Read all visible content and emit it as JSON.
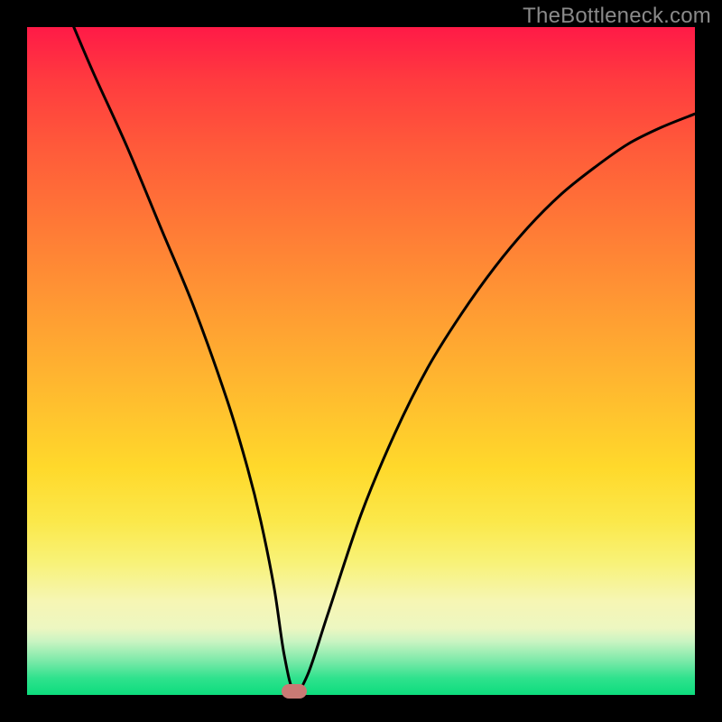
{
  "watermark": "TheBottleneck.com",
  "chart_data": {
    "type": "line",
    "title": "",
    "xlabel": "",
    "ylabel": "",
    "xlim": [
      0,
      100
    ],
    "ylim": [
      0,
      100
    ],
    "grid": false,
    "series": [
      {
        "name": "curve",
        "color": "#000000",
        "x": [
          7,
          10,
          15,
          20,
          25,
          30,
          33,
          35,
          37,
          38.5,
          40,
          42,
          45,
          50,
          55,
          60,
          65,
          70,
          75,
          80,
          85,
          90,
          95,
          100
        ],
        "y": [
          100,
          93,
          82,
          70,
          58,
          44,
          34,
          26,
          16,
          6,
          0.5,
          3,
          12,
          27,
          39,
          49,
          57,
          64,
          70,
          75,
          79,
          82.5,
          85,
          87
        ]
      }
    ],
    "marker": {
      "x": 40,
      "y": 0.5,
      "color": "#c97a74"
    },
    "background_gradient": {
      "top": "#ff1a47",
      "bottom": "#0ddc7d"
    }
  }
}
